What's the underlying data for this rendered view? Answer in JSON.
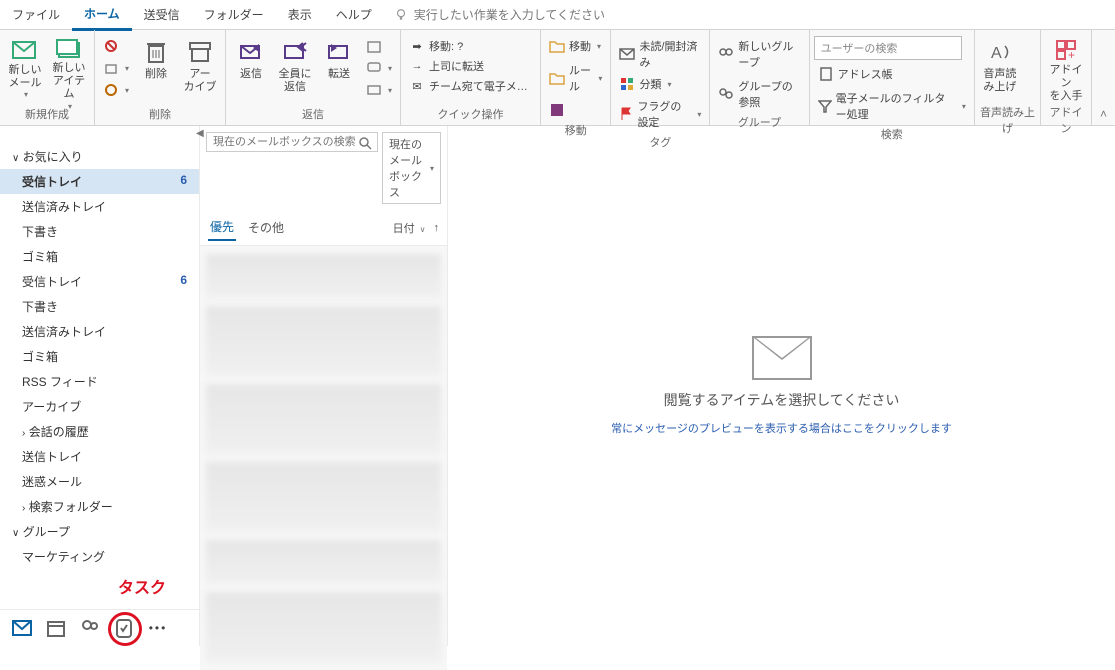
{
  "tabs": {
    "file": "ファイル",
    "home": "ホーム",
    "sendrecv": "送受信",
    "folder": "フォルダー",
    "view": "表示",
    "help": "ヘルプ",
    "tellme": "実行したい作業を入力してください"
  },
  "ribbon": {
    "new": {
      "mail": "新しい\nメール",
      "items": "新しい\nアイテム",
      "label": "新規作成"
    },
    "delete": {
      "delete": "削除",
      "archive": "アー\nカイブ",
      "label": "削除"
    },
    "reply": {
      "reply": "返信",
      "replyall": "全員に\n返信",
      "forward": "転送",
      "label": "返信"
    },
    "quick": {
      "move_q": "移動: ?",
      "to_boss": "上司に転送",
      "team_mail": "チーム宛て電子メ…",
      "label": "クイック操作"
    },
    "move": {
      "move": "移動",
      "rules": "ルール",
      "label": "移動"
    },
    "tags": {
      "unread": "未読/開封済み",
      "category": "分類",
      "flag": "フラグの設定",
      "label": "タグ"
    },
    "groups": {
      "new_group": "新しいグループ",
      "browse": "グループの参照",
      "label": "グループ"
    },
    "find": {
      "placeholder": "ユーザーの検索",
      "address": "アドレス帳",
      "filter": "電子メールのフィルター処理",
      "label": "検索"
    },
    "speech": {
      "read": "音声読\nみ上げ",
      "label": "音声読み上げ"
    },
    "addin": {
      "get": "アドイン\nを入手",
      "label": "アドイン"
    }
  },
  "folders": {
    "favorites": "お気に入り",
    "items1": [
      {
        "name": "受信トレイ",
        "count": "6",
        "sel": true
      },
      {
        "name": "送信済みトレイ"
      },
      {
        "name": "下書き"
      },
      {
        "name": "ゴミ箱"
      }
    ],
    "items2": [
      {
        "name": "受信トレイ",
        "count": "6"
      },
      {
        "name": "下書き"
      },
      {
        "name": "送信済みトレイ"
      },
      {
        "name": "ゴミ箱"
      },
      {
        "name": "RSS フィード"
      },
      {
        "name": "アーカイブ"
      }
    ],
    "conv_hist": "会話の履歴",
    "items3": [
      {
        "name": "送信トレイ"
      },
      {
        "name": "迷惑メール"
      }
    ],
    "search_f": "検索フォルダー",
    "groups": "グループ",
    "group_items": [
      {
        "name": "マーケティング"
      }
    ]
  },
  "msglist": {
    "search_ph": "現在のメールボックスの検索",
    "scope": "現在のメールボックス",
    "tab_focused": "優先",
    "tab_other": "その他",
    "sort": "日付"
  },
  "reading": {
    "hint": "閲覧するアイテムを選択してください",
    "link": "常にメッセージのプレビューを表示する場合はここをクリックします"
  },
  "annotation": {
    "task": "タスク"
  }
}
